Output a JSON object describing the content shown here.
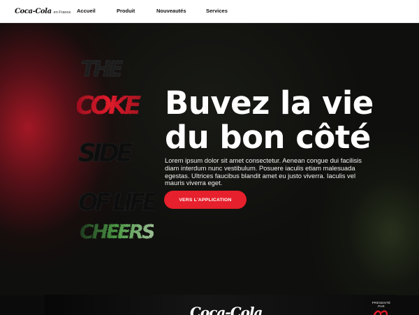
{
  "header": {
    "brand_logo": "Coca-Cola",
    "brand_tag": "en France",
    "nav": [
      {
        "label": "Accueil"
      },
      {
        "label": "Produit"
      },
      {
        "label": "Nouveautés"
      },
      {
        "label": "Services"
      }
    ]
  },
  "hero": {
    "artwork_words": [
      "THE",
      "COKE",
      "SIDE",
      "OF LIFE",
      "CHEERS"
    ],
    "title_line1": "Buvez la vie",
    "title_line2": "du bon côté",
    "lead": "Lorem ipsum dolor sit amet consectetur. Aenean congue dui facilisis diam interdum nunc vestibulum. Posuere iaculis etiam malesuada egestas. Ultrices faucibus blandit amet eu justo viverra. Iaculis vel mauris viverra eget.",
    "cta_label": "VERS L'APPLICATION"
  },
  "banner": {
    "logo_text": "Coca-Cola",
    "presented_label": "PRÉSENTÉ PAR"
  },
  "colors": {
    "accent_red": "#e6202c",
    "art_red": "#c8162a",
    "art_green": "#3f8f3a",
    "nav_bg": "#ffffff"
  },
  "icons": {
    "brand": "coca-cola-script-logo",
    "banner_mark": "coca-cola-red-mark"
  }
}
